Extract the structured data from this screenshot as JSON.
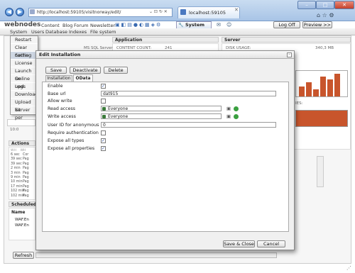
{
  "browser": {
    "url": "http://localhost:59105/visitnorway/edit/",
    "tab_title": "localhost:59105"
  },
  "topnav": {
    "logo": "webnodes",
    "links": [
      "Content",
      "Blog",
      "Forum",
      "Newsletter"
    ],
    "system_tab": "System",
    "logoff": "Log Off",
    "preview": "Preview >>"
  },
  "menu": {
    "items": [
      "System",
      "Users",
      "Database",
      "Indexes",
      "File system"
    ]
  },
  "system_menu": {
    "items": [
      "Restart",
      "Clear cache",
      "Setting",
      "License",
      "Launch Se",
      "Online upd",
      "Logs",
      "Download",
      "Upload kit",
      "Server per"
    ]
  },
  "background": {
    "application": {
      "title": "Application",
      "label": "CONTENT COUNT:",
      "value": "241"
    },
    "server": {
      "title": "Server",
      "label": "DISK USAGE:",
      "value": "340,3 MB"
    },
    "db_label": "MS SQL Server",
    "actions": {
      "title": "Actions",
      "cols": [
        "WH",
        "WH"
      ],
      "rows": [
        [
          "6 sec",
          "Cor"
        ],
        [
          "39 sec",
          "Pag"
        ],
        [
          "39 sec",
          "Pag"
        ],
        [
          "2 min",
          "Pag"
        ],
        [
          "3 min",
          "Pag"
        ],
        [
          "9 min",
          "Pag"
        ],
        [
          "10 min",
          "Pag"
        ],
        [
          "17 min",
          "Pag"
        ],
        [
          "102 min",
          "Pag"
        ],
        [
          "102 min",
          "Pag"
        ]
      ]
    },
    "scheduled": {
      "title": "Scheduled",
      "col": "Name",
      "rows": [
        "WAF.En",
        "WAF.En"
      ]
    },
    "refresh": "Refresh",
    "ies": "IES:",
    "misc": [
      "10:0"
    ]
  },
  "dialog": {
    "title": "Edit Installation",
    "buttons": {
      "save": "Save",
      "deactivate": "Deactivate",
      "delete": "Delete",
      "save_close": "Save & Close",
      "cancel": "Cancel"
    },
    "tabs": [
      "Installation",
      "OData"
    ],
    "fields": {
      "enable": {
        "label": "Enable",
        "checked": true
      },
      "base_url": {
        "label": "Base url",
        "value": "dat915"
      },
      "allow_write": {
        "label": "Allow write",
        "checked": false
      },
      "read_access": {
        "label": "Read access",
        "value": "Everyone"
      },
      "write_access": {
        "label": "Write access",
        "value": "Everyone"
      },
      "anon_user": {
        "label": "User ID for anonymous",
        "value": "0"
      },
      "require_auth": {
        "label": "Require authentication",
        "checked": false
      },
      "expose_types": {
        "label": "Expose all types",
        "checked": true
      },
      "expose_props": {
        "label": "Expose all properties",
        "checked": true
      }
    }
  }
}
